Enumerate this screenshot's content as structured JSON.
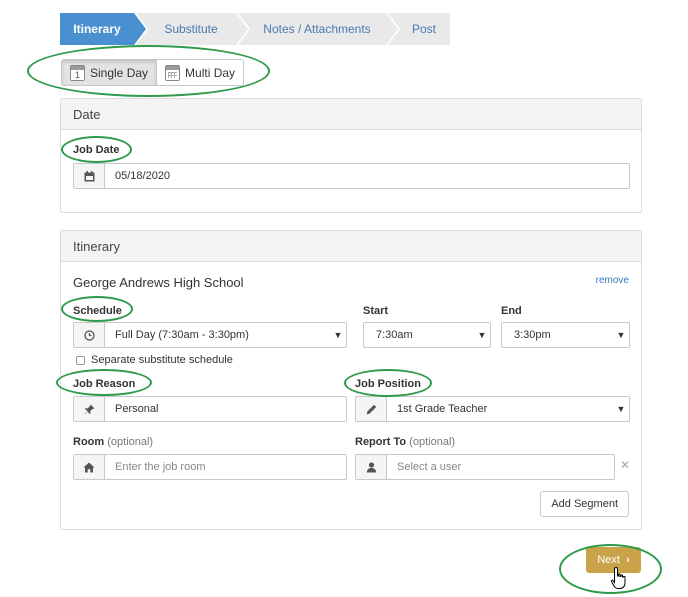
{
  "wizard": {
    "steps": [
      {
        "label": "Itinerary",
        "active": true
      },
      {
        "label": "Substitute",
        "active": false
      },
      {
        "label": "Notes / Attachments",
        "active": false
      },
      {
        "label": "Post",
        "active": false
      }
    ]
  },
  "day_toggle": {
    "single_label": "Single Day",
    "single_icon_number": "1",
    "multi_label": "Multi Day",
    "selected": "single"
  },
  "date_panel": {
    "title": "Date",
    "job_date_label": "Job Date",
    "job_date_value": "05/18/2020",
    "icon": "calendar-icon"
  },
  "itinerary_panel": {
    "title": "Itinerary",
    "school": "George Andrews High School",
    "remove_label": "remove",
    "schedule_label": "Schedule",
    "schedule_value": "Full Day (7:30am - 3:30pm)",
    "start_label": "Start",
    "start_value": "7:30am",
    "end_label": "End",
    "end_value": "3:30pm",
    "separate_schedule_label": "Separate substitute schedule",
    "separate_schedule_checked": false,
    "job_reason_label": "Job Reason",
    "job_reason_value": "Personal",
    "job_position_label": "Job Position",
    "job_position_value": "1st Grade Teacher",
    "room_label": "Room",
    "room_optional": "(optional)",
    "room_placeholder": "Enter the job room",
    "report_to_label": "Report To",
    "report_to_optional": "(optional)",
    "report_to_placeholder": "Select a user",
    "add_segment_label": "Add Segment"
  },
  "footer": {
    "next_label": "Next",
    "next_icon": "chevron-right-icon"
  },
  "colors": {
    "active_step": "#4a8fd0",
    "next_button": "#c9a24a",
    "highlight": "#2e9a4a",
    "link": "#3a7ac0"
  }
}
